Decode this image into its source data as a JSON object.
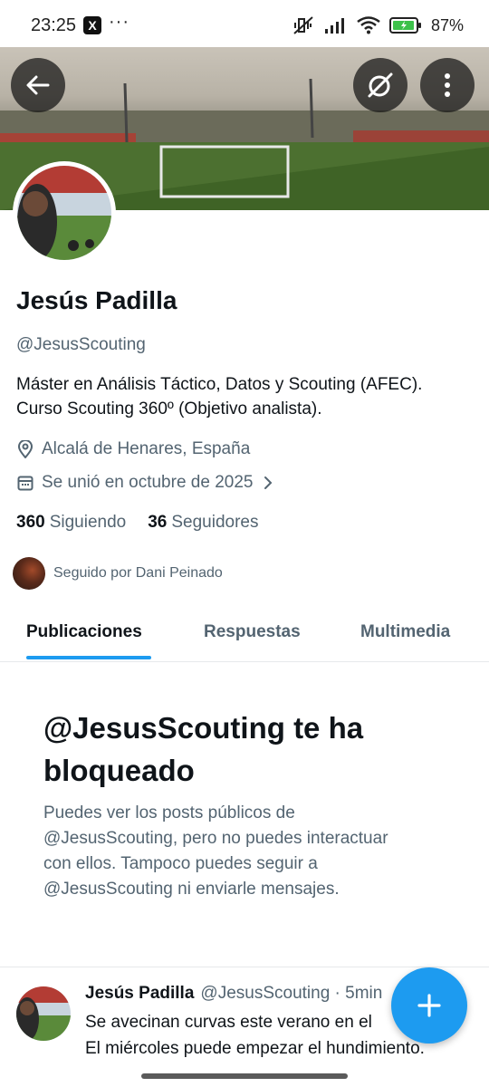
{
  "status_bar": {
    "time": "23:25",
    "app_icon": "X",
    "more": "···",
    "battery": "87%"
  },
  "header": {
    "back_icon": "arrow-left-icon",
    "grok_icon": "grok-icon",
    "more_icon": "more-vertical-icon"
  },
  "profile": {
    "name": "Jesús Padilla",
    "handle": "@JesusScouting",
    "bio_lines": [
      "Máster en Análisis Táctico, Datos y Scouting (AFEC).",
      "Curso Scouting 360º (Objetivo analista)."
    ],
    "location": "Alcalá de Henares, España",
    "joined": "Se unió en octubre de 2025",
    "following_count": "360",
    "following_label": "Siguiendo",
    "followers_count": "36",
    "followers_label": "Seguidores",
    "followed_by": "Seguido por Dani Peinado"
  },
  "tabs": [
    {
      "label": "Publicaciones",
      "active": true
    },
    {
      "label": "Respuestas",
      "active": false
    },
    {
      "label": "Multimedia",
      "active": false
    }
  ],
  "blocked": {
    "title_lines": [
      "@JesusScouting te ha",
      "bloqueado"
    ],
    "text_lines": [
      "Puedes ver los posts públicos de",
      "@JesusScouting, pero no puedes interactuar",
      "con ellos. Tampoco puedes seguir a",
      "@JesusScouting ni enviarle mensajes."
    ]
  },
  "post": {
    "name": "Jesús Padilla",
    "handle_time": "@JesusScouting · 5min",
    "text_lines": [
      "Se avecinan curvas este verano en el",
      "El miércoles puede empezar el hundimiento."
    ]
  },
  "colors": {
    "accent": "#1d9bf0",
    "text_primary": "#0f1419",
    "text_secondary": "#536471"
  }
}
